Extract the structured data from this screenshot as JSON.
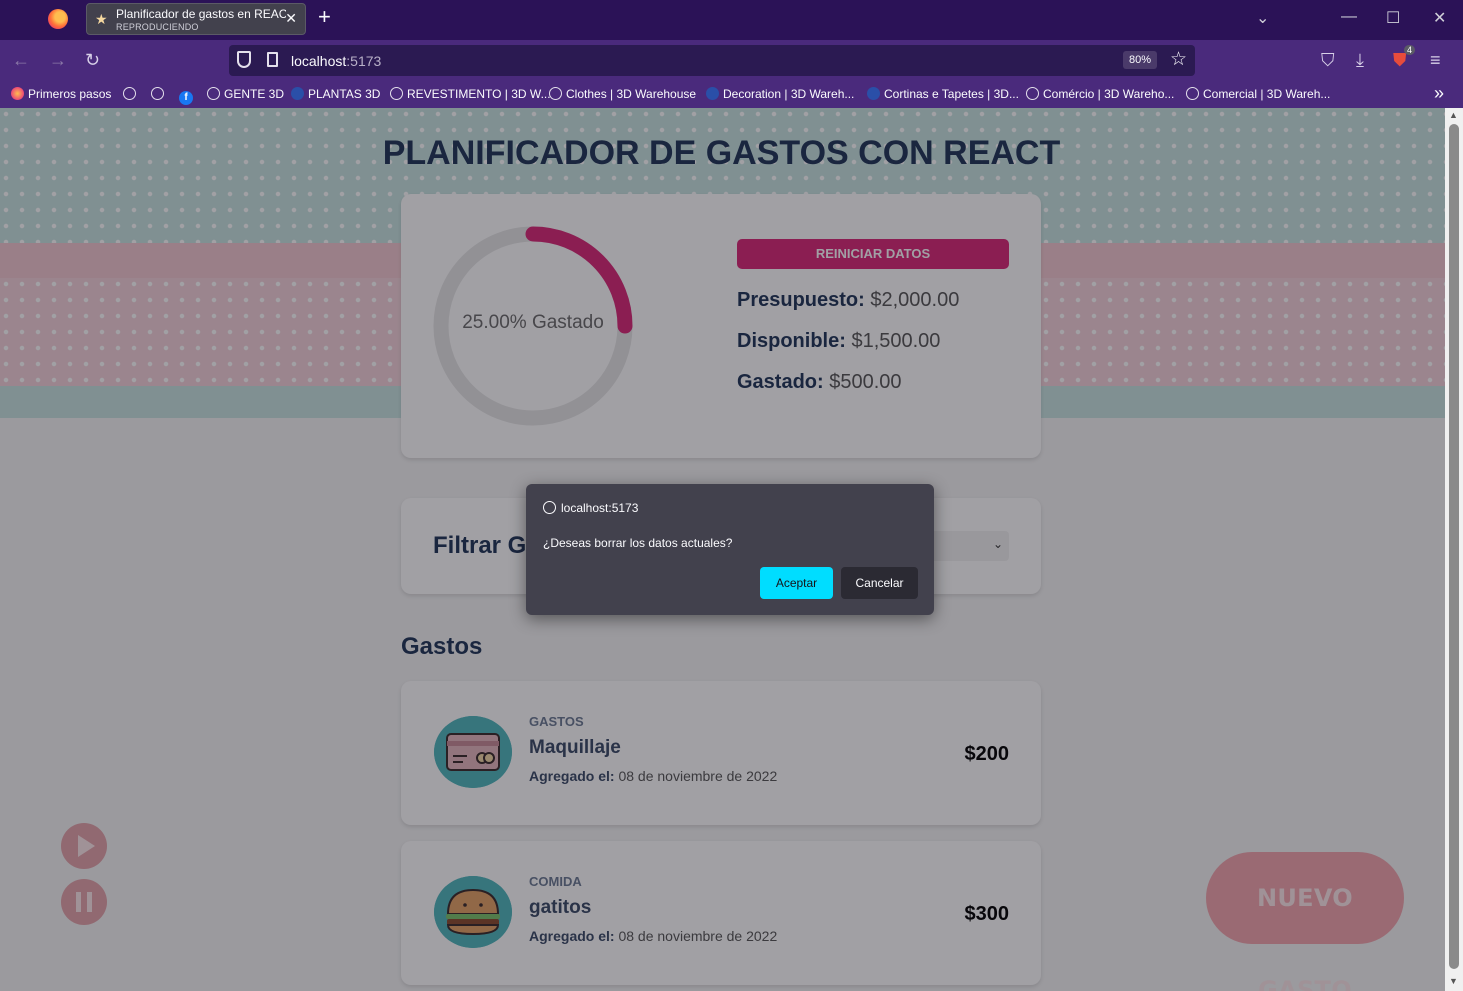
{
  "browser": {
    "tab_title": "Planificador de gastos en REACT",
    "tab_subtitle": "REPRODUCIENDO",
    "url_host": "localhost",
    "url_port": ":5173",
    "zoom": "80%",
    "downloads_badge": "4"
  },
  "bookmarks": [
    {
      "label": "Primeros pasos"
    },
    {
      "label": "GENTE 3D"
    },
    {
      "label": "PLANTAS 3D"
    },
    {
      "label": "REVESTIMENTO | 3D W..."
    },
    {
      "label": "Clothes | 3D Warehouse"
    },
    {
      "label": "Decoration | 3D Wareh..."
    },
    {
      "label": "Cortinas e Tapetes | 3D..."
    },
    {
      "label": "Comércio | 3D Wareho..."
    },
    {
      "label": "Comercial | 3D Wareh..."
    }
  ],
  "app": {
    "title": "PLANIFICADOR DE GASTOS CON REACT",
    "progress_label": "25.00% Gastado",
    "progress_value": 0.25,
    "reset_label": "REINICIAR DATOS",
    "budget_label": "Presupuesto:",
    "budget_value": "$2,000.00",
    "available_label": "Disponible:",
    "available_value": "$1,500.00",
    "spent_label": "Gastado:",
    "spent_value": "$500.00",
    "filter_label": "Filtrar Ga",
    "expenses_heading": "Gastos",
    "new_expense_label": "NUEVO GASTO",
    "expenses": [
      {
        "category": "GASTOS",
        "name": "Maquillaje",
        "added_label": "Agregado el:",
        "date": "08 de noviembre de 2022",
        "amount": "$200"
      },
      {
        "category": "COMIDA",
        "name": "gatitos",
        "added_label": "Agregado el:",
        "date": "08 de noviembre de 2022",
        "amount": "$300"
      }
    ]
  },
  "dialog": {
    "origin": "localhost:5173",
    "message": "¿Deseas borrar los datos actuales?",
    "accept_label": "Aceptar",
    "cancel_label": "Cancelar"
  },
  "colors": {
    "progress_stroke": "#db2777",
    "accent": "#00ddff",
    "reset_bg": "#db2777"
  }
}
